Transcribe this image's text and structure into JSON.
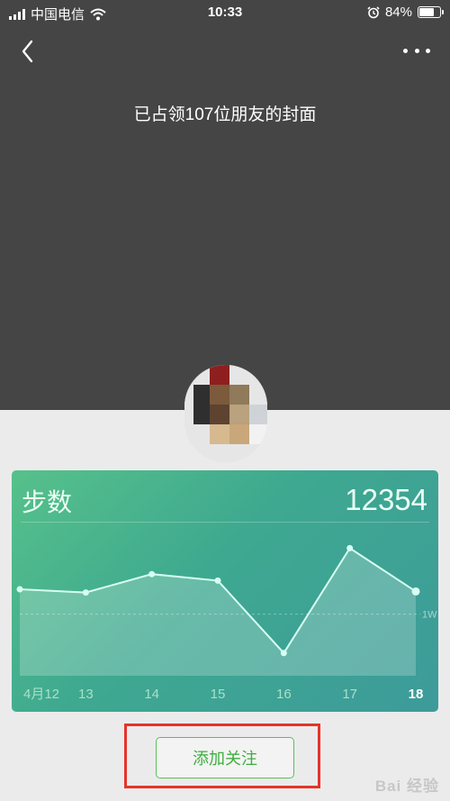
{
  "status_bar": {
    "carrier": "中国电信",
    "time": "10:33",
    "battery_percent": "84%",
    "battery_level": 0.84
  },
  "icons": {
    "back": "chevron-left-icon",
    "more": "more-dots-icon",
    "wifi": "wifi-icon",
    "alarm": "alarm-icon"
  },
  "cover": {
    "title": "已占领107位朋友的封面"
  },
  "steps_card": {
    "title": "步数",
    "value": "12354"
  },
  "chart_data": {
    "type": "area",
    "categories": [
      "4月12",
      "13",
      "14",
      "15",
      "16",
      "17",
      "18"
    ],
    "values": [
      8000,
      7700,
      9400,
      8800,
      2100,
      11800,
      7800
    ],
    "reference_line": {
      "value": 5700,
      "label": "1W"
    },
    "ylim": [
      0,
      14000
    ],
    "highlight_category": "18",
    "colors": {
      "line": "#d6fff2",
      "fill": "rgba(255,255,255,0.22)",
      "label": "#a9e0c8",
      "label_active": "#ffffff"
    }
  },
  "actions": {
    "follow_label": "添加关注"
  },
  "watermark": "Bai 经验"
}
